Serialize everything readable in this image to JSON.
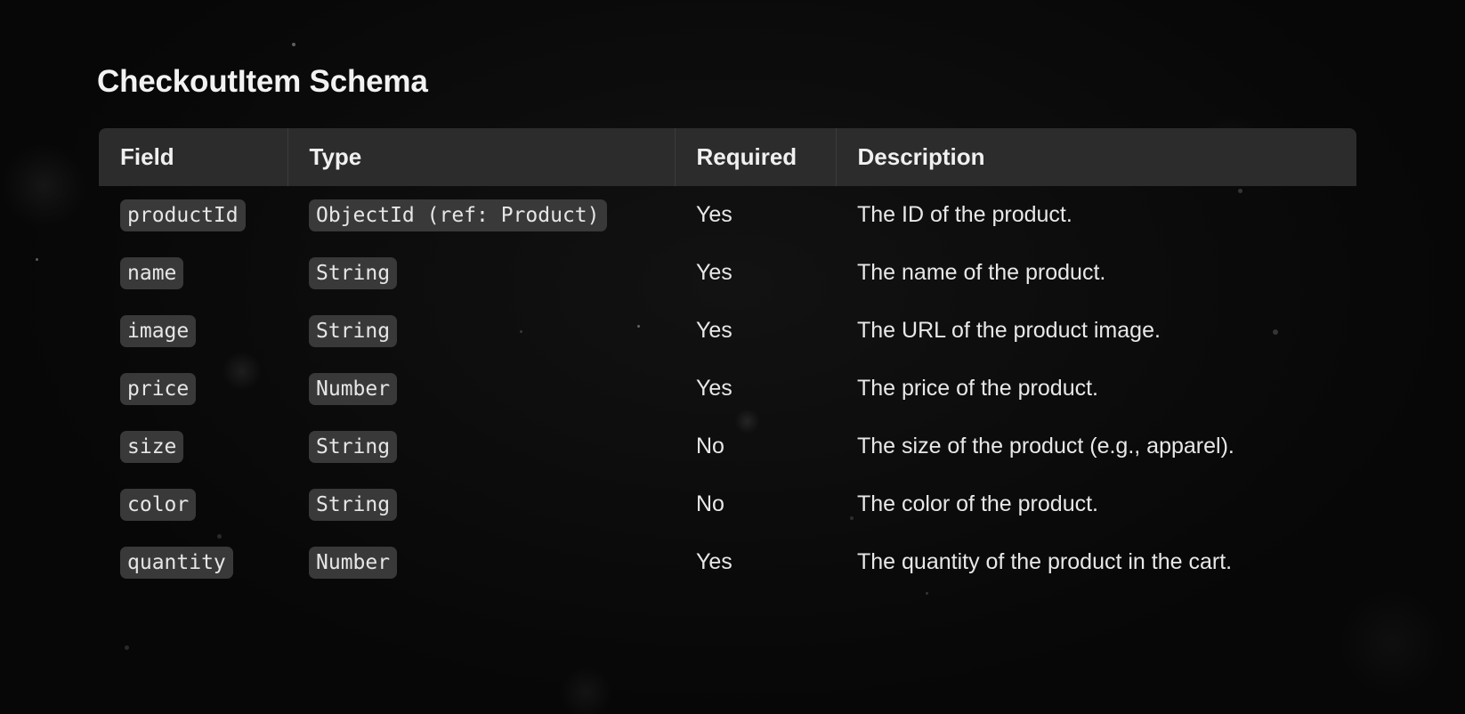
{
  "title": "CheckoutItem Schema",
  "headers": {
    "field": "Field",
    "type": "Type",
    "required": "Required",
    "description": "Description"
  },
  "rows": [
    {
      "field": "productId",
      "type": "ObjectId (ref: Product)",
      "required": "Yes",
      "description": "The ID of the product."
    },
    {
      "field": "name",
      "type": "String",
      "required": "Yes",
      "description": "The name of the product."
    },
    {
      "field": "image",
      "type": "String",
      "required": "Yes",
      "description": "The URL of the product image."
    },
    {
      "field": "price",
      "type": "Number",
      "required": "Yes",
      "description": "The price of the product."
    },
    {
      "field": "size",
      "type": "String",
      "required": "No",
      "description": "The size of the product (e.g., apparel)."
    },
    {
      "field": "color",
      "type": "String",
      "required": "No",
      "description": "The color of the product."
    },
    {
      "field": "quantity",
      "type": "Number",
      "required": "Yes",
      "description": "The quantity of the product in the cart."
    }
  ]
}
